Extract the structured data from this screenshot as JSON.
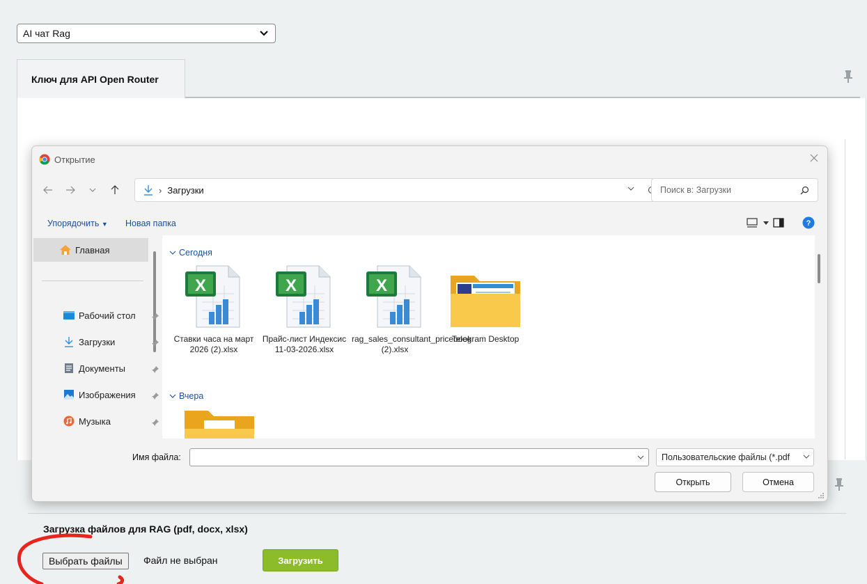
{
  "top_select": {
    "value": "AI чат Rag"
  },
  "tab": {
    "label": "Ключ для API Open Router"
  },
  "dialog": {
    "title": "Открытие",
    "address": {
      "folder": "Загрузки"
    },
    "search": {
      "placeholder": "Поиск в: Загрузки"
    },
    "commands": {
      "organize": "Упорядочить",
      "new_folder": "Новая папка"
    },
    "sidebar": [
      {
        "label": "Главная"
      },
      {
        "label": "Рабочий стол"
      },
      {
        "label": "Загрузки"
      },
      {
        "label": "Документы"
      },
      {
        "label": "Изображения"
      },
      {
        "label": "Музыка"
      }
    ],
    "groups": {
      "today": "Сегодня",
      "yesterday": "Вчера"
    },
    "files": [
      {
        "name": "Ставки часа на март 2026 (2).xlsx",
        "type": "excel"
      },
      {
        "name": "Прайс-лист Индексис 11-03-2026.xlsx",
        "type": "excel"
      },
      {
        "name": "rag_sales_consultant_pricebook (2).xlsx",
        "type": "excel"
      },
      {
        "name": "Telegram Desktop",
        "type": "folder"
      }
    ],
    "filename": {
      "label": "Имя файла:",
      "value": ""
    },
    "filter": {
      "value": "Пользовательские файлы (*.pdf"
    },
    "buttons": {
      "open": "Открыть",
      "cancel": "Отмена"
    }
  },
  "upload": {
    "heading": "Загрузка файлов для RAG (pdf, docx, xlsx)",
    "choose_button": "Выбрать файлы",
    "status": "Файл не выбран",
    "submit_button": "Загрузить"
  },
  "colors": {
    "accent_green": "#8dbc2a",
    "link_blue": "#1a4f9c",
    "annotation_red": "#e8241c"
  }
}
